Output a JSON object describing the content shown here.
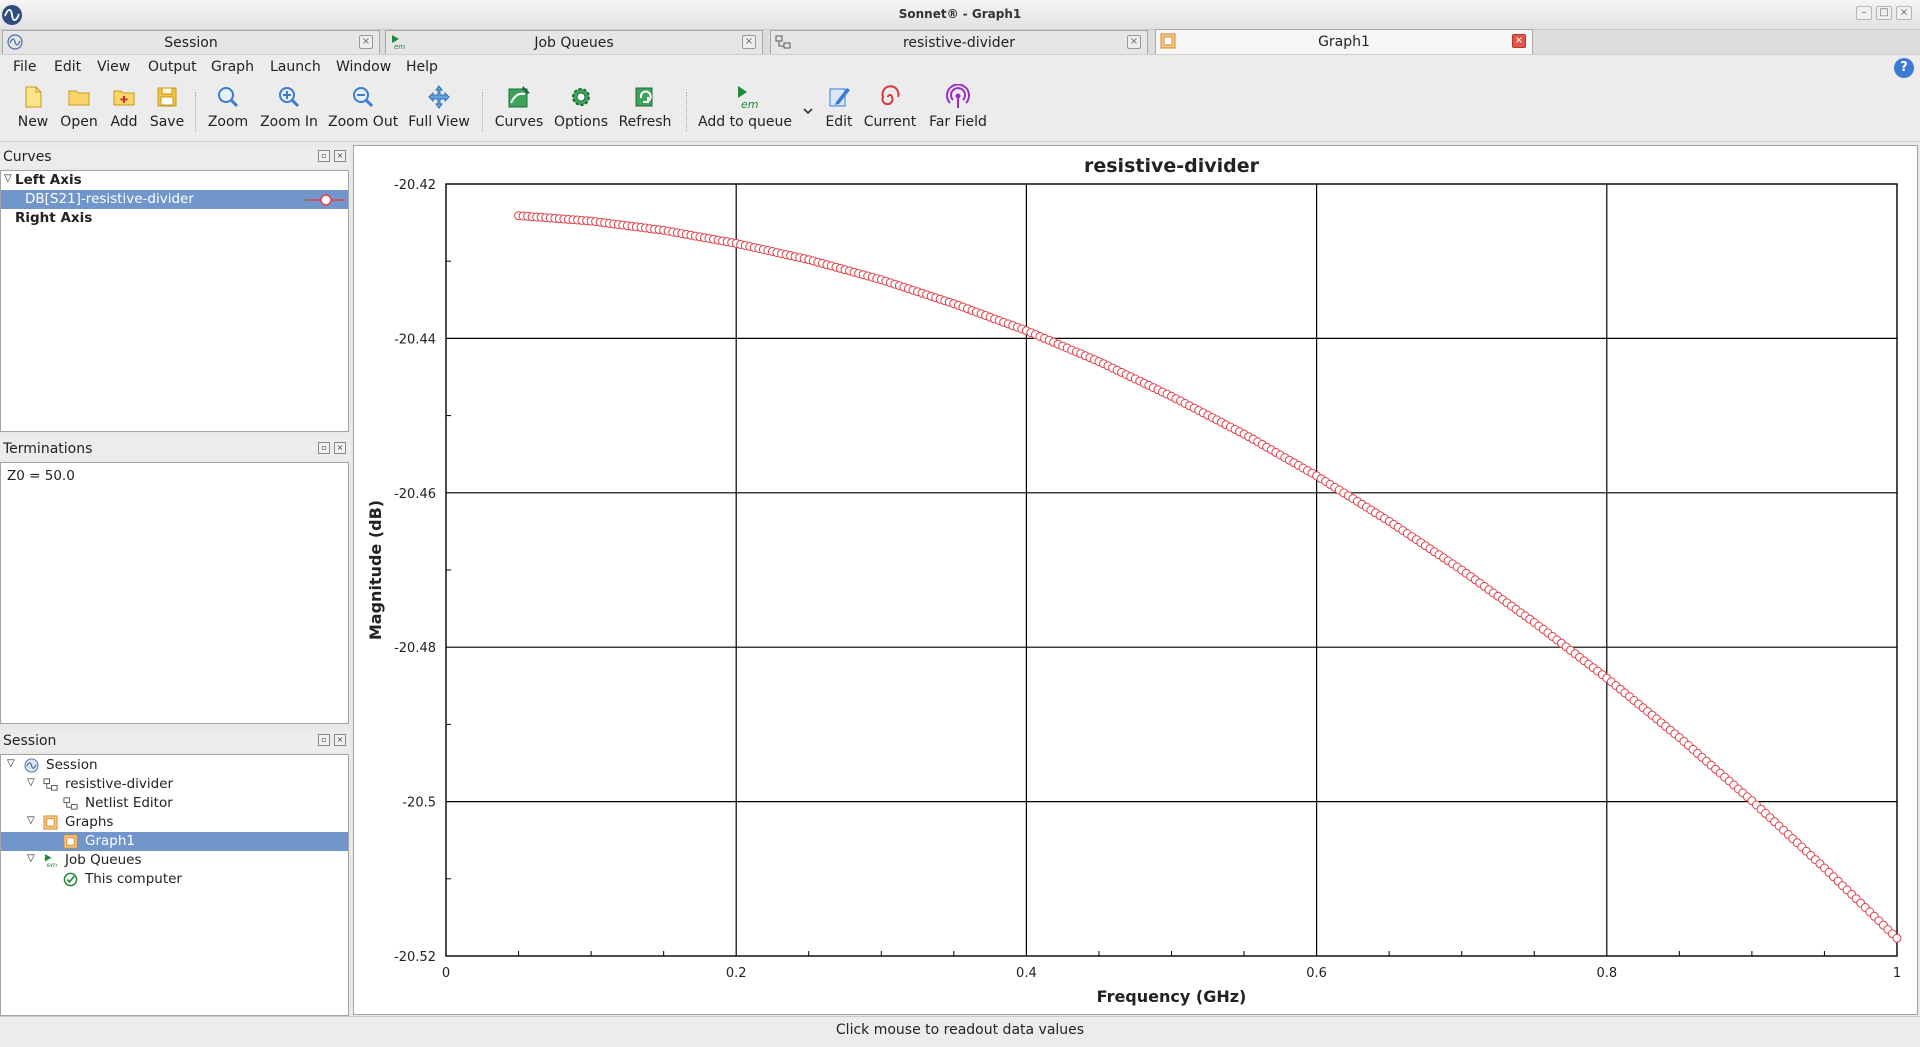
{
  "window": {
    "title": "Sonnet® - Graph1"
  },
  "tabs": [
    {
      "label": "Session",
      "icon": "sonnet-wave-icon",
      "active": false
    },
    {
      "label": "Job Queues",
      "icon": "em-run-icon",
      "active": false
    },
    {
      "label": "resistive-divider",
      "icon": "netlist-icon",
      "active": false
    },
    {
      "label": "Graph1",
      "icon": "graph-icon",
      "active": true
    }
  ],
  "menu": [
    {
      "label": "File"
    },
    {
      "label": "Edit"
    },
    {
      "label": "View"
    },
    {
      "label": "Output"
    },
    {
      "label": "Graph"
    },
    {
      "label": "Launch"
    },
    {
      "label": "Window"
    },
    {
      "label": "Help"
    }
  ],
  "toolbar": [
    {
      "label": "New",
      "icon": "new-file-icon"
    },
    {
      "label": "Open",
      "icon": "open-folder-icon"
    },
    {
      "label": "Add",
      "icon": "add-folder-icon"
    },
    {
      "label": "Save",
      "icon": "save-icon"
    },
    {
      "label": "Zoom",
      "icon": "zoom-icon"
    },
    {
      "label": "Zoom In",
      "icon": "zoom-in-icon"
    },
    {
      "label": "Zoom Out",
      "icon": "zoom-out-icon"
    },
    {
      "label": "Full View",
      "icon": "full-view-icon"
    },
    {
      "label": "Curves",
      "icon": "curves-icon"
    },
    {
      "label": "Options",
      "icon": "options-icon"
    },
    {
      "label": "Refresh",
      "icon": "refresh-icon"
    },
    {
      "label": "Add to queue",
      "icon": "em-run-icon"
    },
    {
      "label": "Edit",
      "icon": "edit-icon"
    },
    {
      "label": "Current",
      "icon": "current-icon"
    },
    {
      "label": "Far Field",
      "icon": "far-field-icon"
    }
  ],
  "curves_panel": {
    "title": "Curves",
    "left_axis": "Left Axis",
    "curve": "DB[S21]-resistive-divider",
    "right_axis": "Right Axis"
  },
  "terminations_panel": {
    "title": "Terminations",
    "value": "Z0 = 50.0"
  },
  "session_panel": {
    "title": "Session",
    "items": [
      {
        "label": "Session"
      },
      {
        "label": "resistive-divider"
      },
      {
        "label": "Netlist Editor"
      },
      {
        "label": "Graphs"
      },
      {
        "label": "Graph1"
      },
      {
        "label": "Job Queues"
      },
      {
        "label": "This computer"
      }
    ]
  },
  "status": {
    "text": "Click mouse to readout data values"
  },
  "colors": {
    "curve": "#e0404a",
    "selection": "#7096cc",
    "accent": "#3b7bd3"
  },
  "chart_data": {
    "type": "scatter",
    "title": "resistive-divider",
    "xlabel": "Frequency (GHz)",
    "ylabel": "Magnitude (dB)",
    "xlim": [
      0,
      1
    ],
    "ylim": [
      -20.52,
      -20.42
    ],
    "xticks": [
      "0",
      "0.2",
      "0.4",
      "0.6",
      "0.8",
      "1"
    ],
    "yticks": [
      "-20.42",
      "-20.44",
      "-20.46",
      "-20.48",
      "-20.5",
      "-20.52"
    ],
    "grid": true,
    "series": [
      {
        "name": "DB[S21]-resistive-divider",
        "x": [
          0.05,
          0.1,
          0.15,
          0.2,
          0.25,
          0.3,
          0.35,
          0.4,
          0.45,
          0.5,
          0.55,
          0.6,
          0.65,
          0.7,
          0.75,
          0.8,
          0.85,
          0.9,
          0.95,
          1.0
        ],
        "y": [
          -20.4241,
          -20.4248,
          -20.426,
          -20.4277,
          -20.4298,
          -20.4324,
          -20.4355,
          -20.439,
          -20.443,
          -20.4475,
          -20.4524,
          -20.4578,
          -20.4637,
          -20.47,
          -20.4768,
          -20.484,
          -20.4917,
          -20.4999,
          -20.5086,
          -20.5177
        ]
      }
    ]
  }
}
